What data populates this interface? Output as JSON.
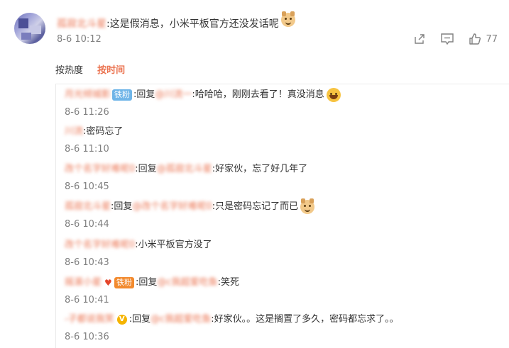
{
  "main_comment": {
    "user": "孤寂北斗星",
    "text": ":这是假消息，小米平板官方还没发话呢",
    "time": "8-6 10:12",
    "like_count": "77"
  },
  "sort": {
    "hot": "按热度",
    "time": "按时间"
  },
  "replies": [
    {
      "user": "月光倾城影",
      "badge": "铁粉",
      "prefix": ":回复",
      "target": "@川流一",
      "text": ":哈哈哈，刚刚去看了！真没消息",
      "emoji": "laugh",
      "time": "8-6 11:26"
    },
    {
      "user": "川流",
      "text": ":密码忘了",
      "time": "8-6 11:10"
    },
    {
      "user": "改个名字好难呢0",
      "prefix": ":回复",
      "target": "@孤寂北斗星",
      "text": ":好家伙，忘了好几年了",
      "time": "8-6 10:45"
    },
    {
      "user": "孤寂北斗星",
      "prefix": ":回复",
      "target": "@改个名字好难呢0",
      "text": ":只是密码忘记了而已",
      "emoji": "dog",
      "time": "8-6 10:44"
    },
    {
      "user": "改个名字好难呢0",
      "text": ":小米平板官方没了",
      "time": "8-6 10:43"
    },
    {
      "user": "摇滚小星",
      "badge": "铁粉",
      "prefix": ":回复",
      "target": "@c我超爱吃鱼",
      "text": ":笑死",
      "time": "8-6 10:41"
    },
    {
      "user": "-子都说我笑",
      "prefix": ":回复",
      "target": "@c我超爱吃鱼",
      "text": ":好家伙。。这是搁置了多久，密码都忘求了。。",
      "time": "8-6 10:36"
    }
  ]
}
